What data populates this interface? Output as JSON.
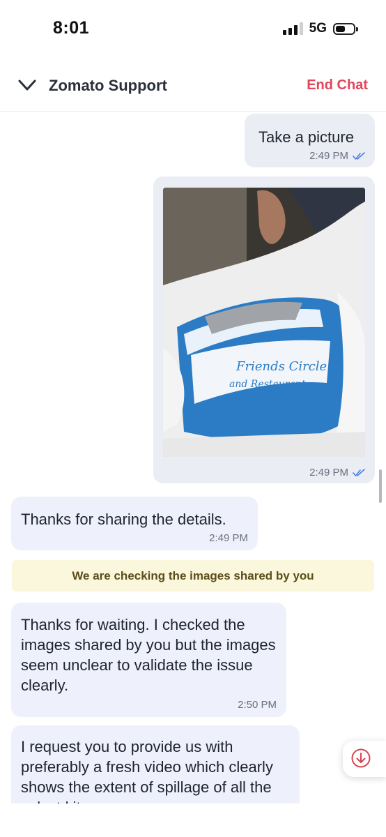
{
  "status_bar": {
    "time": "8:01",
    "network": "5G"
  },
  "header": {
    "title": "Zomato Support",
    "end_chat_label": "End Chat"
  },
  "messages": [
    {
      "text": "Take a picture",
      "time": "2:49 PM"
    },
    {
      "image": "photo",
      "time": "2:49 PM"
    },
    {
      "text": "Thanks for sharing the details.",
      "time": "2:49 PM"
    },
    {
      "text": "Thanks for waiting. I checked the images shared by you but the images seem unclear to validate the issue clearly.",
      "time": "2:50 PM"
    },
    {
      "text": "I request you to provide us with preferably a fresh video which clearly shows the extent of spillage of all the select kit..."
    }
  ],
  "system_note": "We are checking the images shared by you",
  "colors": {
    "accent": "#e0475a",
    "outgoing_bubble": "#ebedf5",
    "incoming_bubble": "#eef1fb",
    "note_bg": "#fbf7dc",
    "tick": "#4a7fe0"
  },
  "icons": [
    "chevron-down-icon",
    "double-check-icon",
    "arrow-down-circle-icon",
    "signal-icon",
    "battery-icon"
  ]
}
